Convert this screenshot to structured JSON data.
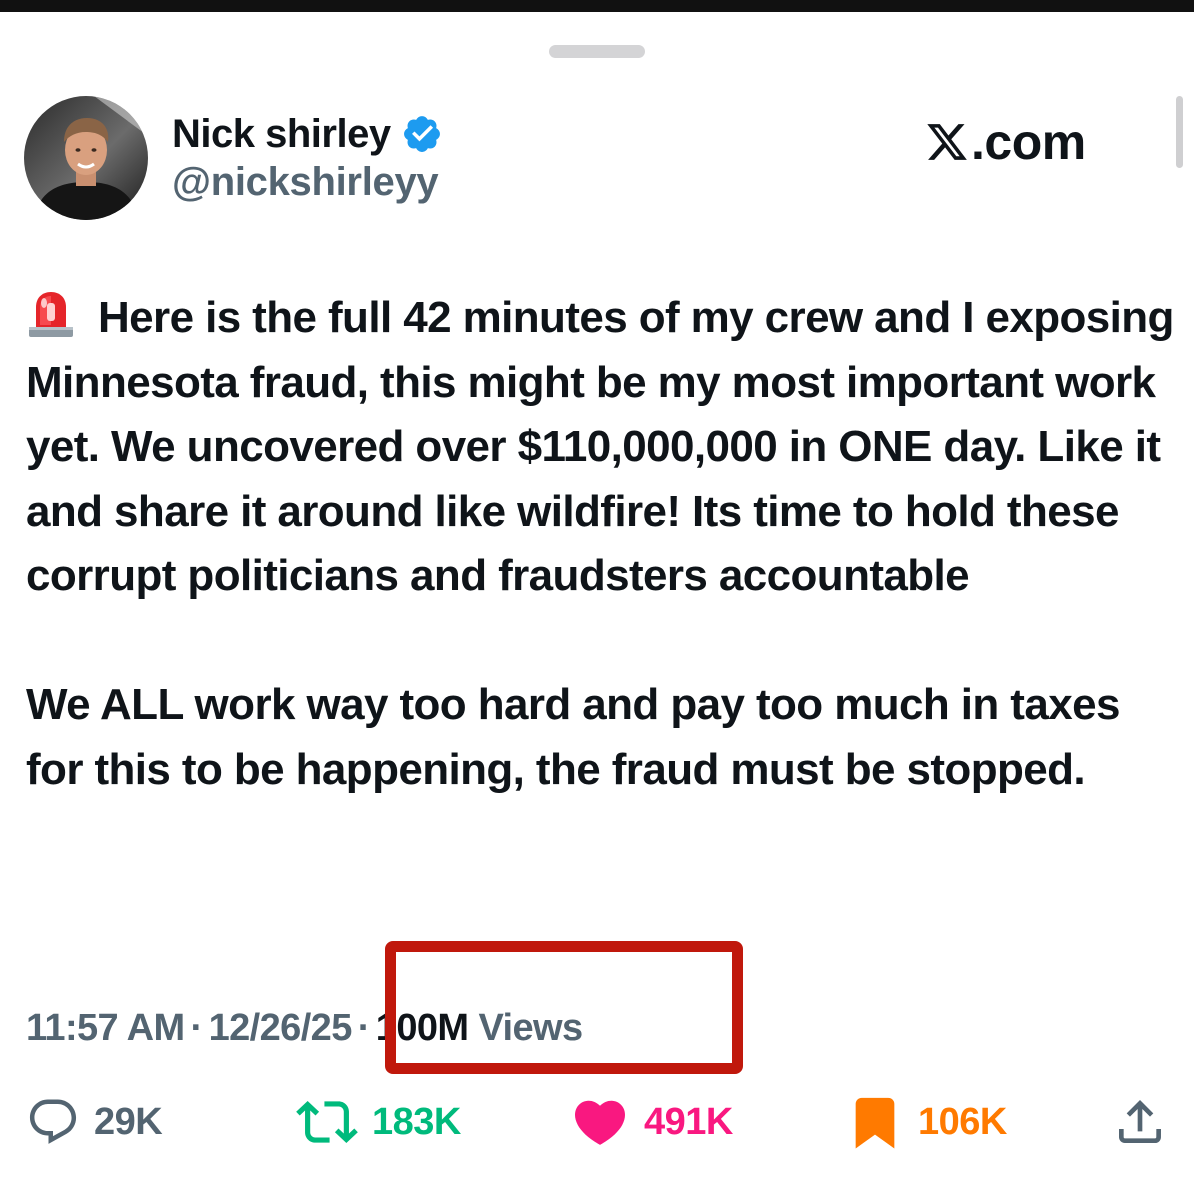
{
  "author": {
    "display_name": "Nick shirley",
    "handle": "@nickshirleyy",
    "verified": true
  },
  "brand": {
    "text": ".com",
    "icon": "x-logo-icon"
  },
  "tweet": {
    "paragraphs": [
      "Here is the full 42 minutes of my crew and I exposing Minnesota fraud, this might be my most important work yet. We uncovered over $110,000,000 in ONE day. Like it and share it around like wildfire! Its time to hold these corrupt politicians and fraudsters accountable",
      "We ALL work way too hard and pay too much in taxes for this to be happening, the fraud must be stopped."
    ],
    "leading_icon": "police-siren-icon"
  },
  "meta": {
    "time": "11:57 AM",
    "separator": "·",
    "date": "12/26/25",
    "views_count": "100M",
    "views_label": "Views"
  },
  "actions": {
    "replies": "29K",
    "reposts": "183K",
    "likes": "491K",
    "bookmarks": "106K"
  },
  "colors": {
    "text": "#0f1419",
    "secondary": "#536471",
    "verified_blue": "#1d9bf0",
    "repost_green": "#00ba7c",
    "like_pink": "#f91880",
    "bookmark_orange": "#ff7a00",
    "highlight_red": "#c0180c"
  }
}
